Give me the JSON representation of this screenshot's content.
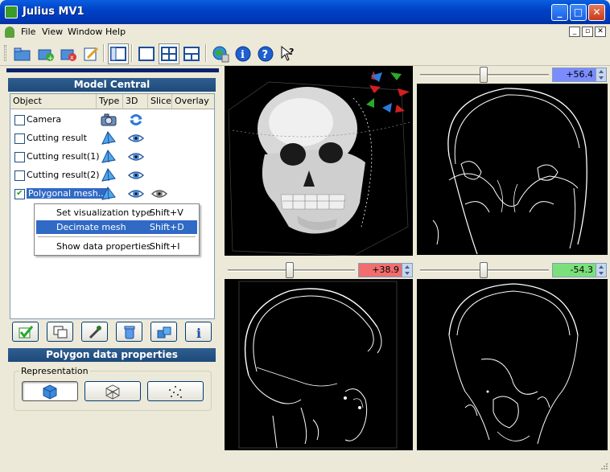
{
  "window": {
    "title": "Julius MV1",
    "minimize": "_",
    "maximize": "□",
    "close": "✕"
  },
  "menu": {
    "items": [
      "File",
      "View",
      "Window",
      "Help"
    ]
  },
  "toolbar": {
    "buttons": [
      "open-folder-icon",
      "add-data-icon",
      "remove-data-icon",
      "edit-icon",
      "single-view-icon",
      "one-view-icon",
      "four-view-icon",
      "three-view-icon",
      "globe-db-icon",
      "info-icon",
      "help-icon",
      "context-help-icon"
    ]
  },
  "model_central": {
    "title": "Model Central",
    "columns": [
      "Object",
      "Type",
      "3D",
      "Slice",
      "Overlay"
    ],
    "rows": [
      {
        "label": "Camera",
        "checked": false,
        "type_icon": "camera-icon",
        "d3_icon": "rotate-icon"
      },
      {
        "label": "Cutting result",
        "checked": false,
        "type_icon": "mesh-icon",
        "d3_icon": "eye-icon"
      },
      {
        "label": "Cutting result(1)",
        "checked": false,
        "type_icon": "mesh-icon",
        "d3_icon": "eye-icon"
      },
      {
        "label": "Cutting result(2)",
        "checked": false,
        "type_icon": "mesh-icon",
        "d3_icon": "eye-icon"
      },
      {
        "label": "Polygonal mesh...",
        "checked": true,
        "type_icon": "mesh-icon",
        "d3_icon": "eye-icon",
        "slice_icon": "eye-icon"
      }
    ]
  },
  "context_menu": {
    "items": [
      {
        "label": "Set visualization type",
        "shortcut": "Shift+V"
      },
      {
        "label": "Decimate mesh",
        "shortcut": "Shift+D"
      },
      {
        "label": "Show data properties",
        "shortcut": "Shift+I"
      }
    ]
  },
  "polygon_props": {
    "title": "Polygon data properties",
    "group": "Representation"
  },
  "viewports": {
    "top_right": {
      "value": "+56.4 mm",
      "color": "#7b8cff"
    },
    "bottom_left": {
      "value": "+38.9 mm",
      "color": "#f06e6e"
    },
    "bottom_right": {
      "value": "-54.3 mm",
      "color": "#7be07b"
    }
  }
}
